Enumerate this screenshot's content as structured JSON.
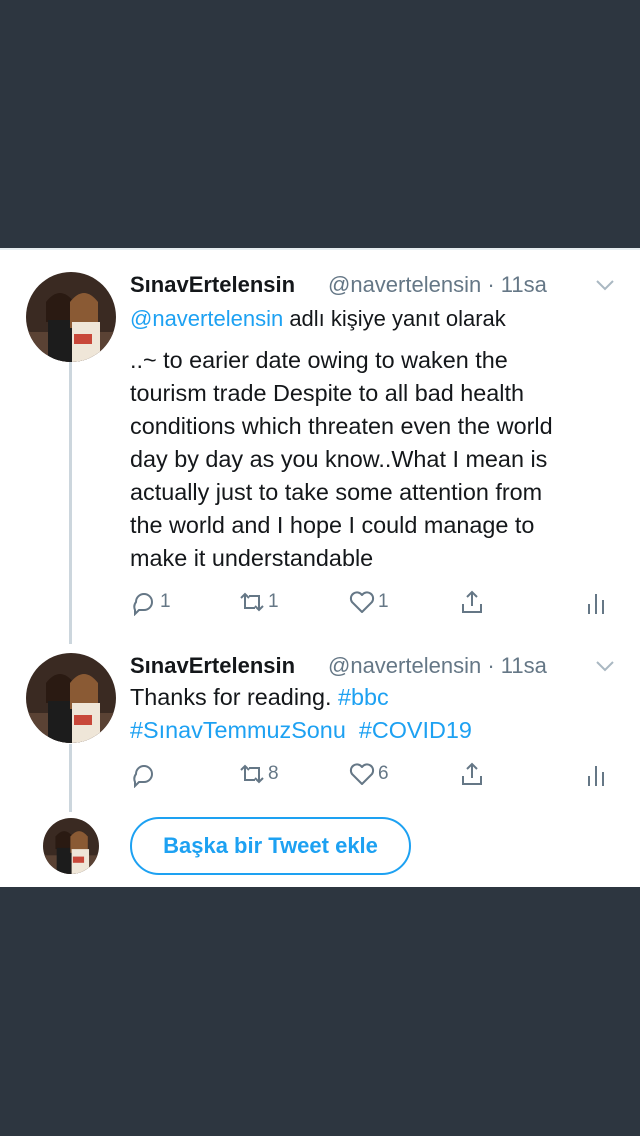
{
  "tweets": [
    {
      "display_name": "SınavErtelensin",
      "handle": "@navertelensin",
      "time": "· 11sa",
      "reply_to_prefix": "@navertelensin",
      "reply_to_suffix": " adlı kişiye yanıt olarak",
      "lines": [
        "..~ to earier date owing to waken the",
        "tourism trade Despite to all bad health",
        "conditions which threaten even the world",
        "day by day as you know..What I mean is",
        "actually just to take some  attention from",
        "the world and I hope I could manage to",
        "make it understandable"
      ],
      "reply_count": "1",
      "retweet_count": "1",
      "like_count": "1"
    },
    {
      "display_name": "SınavErtelensin",
      "handle": "@navertelensin",
      "time": "· 11sa",
      "line1_text": "Thanks for reading. ",
      "line1_tag": "#bbc",
      "line2_tag1": "#SınavTemmuzSonu",
      "line2_tag2": "#COVID19",
      "reply_count": "",
      "retweet_count": "8",
      "like_count": "6"
    }
  ],
  "add_tweet_label": "Başka bir Tweet ekle",
  "colors": {
    "accent": "#1da1f2",
    "secondary_text": "#657786",
    "primary_text": "#14171a",
    "background_dark": "#2d3640",
    "thread_line": "#ccd6dd"
  },
  "icons": [
    "avatar",
    "chevron-down-icon",
    "reply-icon",
    "retweet-icon",
    "like-icon",
    "share-icon",
    "analytics-icon"
  ]
}
